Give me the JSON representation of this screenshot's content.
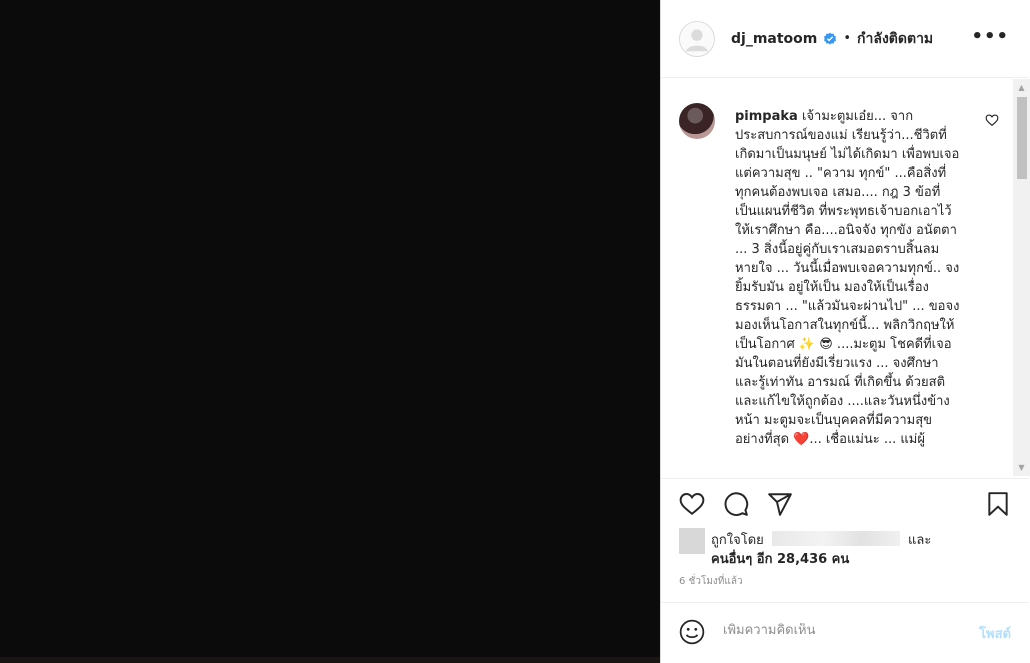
{
  "post": {
    "author": "dj_matoom",
    "verified": true,
    "separator": "•",
    "follow_status": "กำลังติดตาม",
    "more_label": "•••"
  },
  "comment": {
    "username": "pimpaka",
    "text": "เจ้ามะตูมเอ๋ย... จากประสบการณ์ของแม่ เรียนรู้ว่า...ชีวิตที่เกิดมาเป็นมนุษย์ ไม่ได้เกิดมา เพื่อพบเจอแต่ความสุข .. \"ความ ทุกข์\" ...คือสิ่งที่ทุกคนต้องพบเจอ เสมอ.... กฎ 3 ข้อที่เป็นแผนที่ชีวิต ที่พระพุทธเจ้าบอกเอาไว้ให้เราศึกษา คือ....อนิจจัง ทุกขัง อนัตตา ... 3 สิ่งนี้อยู่คู่กับเราเสมอตราบสิ้นลมหายใจ ... วันนี้เมื่อพบเจอความทุกข์.. จงยิ้มรับมัน อยู่ให้เป็น มองให้เป็นเรื่องธรรมดา ... \"แล้วมันจะผ่านไป\" ... ขอจงมองเห็นโอกาสในทุกข์นี้... พลิกวิกฤษให้เป็นโอกาศ ✨ 😎 ....มะตูม โชคดีที่เจอมันในตอนที่ยังมีเรี่ยวแรง ... จงศึกษา และรู้เท่าทัน อารมณ์ ที่เกิดขึ้น ด้วยสติ และแก้ไขให้ถูกต้อง ....และวันหนึ่งข้างหน้า มะตูมจะเป็นบุคคลที่มีความสุขอย่างที่สุด ❤️... เชื่อแม่นะ ... แม่ผู้"
  },
  "likes": {
    "prefix": "ถูกใจโดย",
    "suffix": "และ",
    "others": "คนอื่นๆ อีก 28,436 คน"
  },
  "timestamp": "6 ชั่วโมงที่แล้ว",
  "add_comment": {
    "placeholder": "เพิ่มความคิดเห็น",
    "post_label": "โพสต์"
  },
  "scrollbar": {
    "up": "▲",
    "down": "▼"
  },
  "icons": [
    "verified-badge-icon",
    "more-icon",
    "heart-icon",
    "comment-icon",
    "share-icon",
    "bookmark-icon",
    "emoji-icon",
    "small-heart-icon"
  ],
  "colors": {
    "verified": "#3897f0",
    "post_button": "#b2dffc",
    "text": "#262626",
    "muted": "#8e8e8e"
  }
}
